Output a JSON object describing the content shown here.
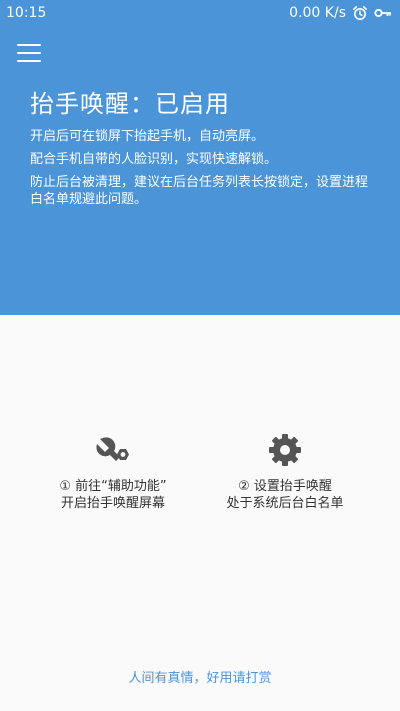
{
  "status_bar": {
    "time": "10:15",
    "net_speed": "0.00 K/s",
    "icons": [
      "alarm-icon",
      "key-icon"
    ]
  },
  "colors": {
    "header_bg": "#4a94d7",
    "accent": "#4a94d7",
    "icon_gray": "#555555",
    "body_bg": "#fafafa"
  },
  "header": {
    "menu_icon": "hamburger-menu-icon",
    "title": "抬手唤醒：已启用",
    "description": [
      "开启后可在锁屏下抬起手机，自动亮屏。",
      "配合手机自带的人脸识别，实现快速解锁。",
      "防止后台被清理，建议在后台任务列表长按锁定，设置进程白名单规避此问题。"
    ]
  },
  "actions": [
    {
      "icon": "accessibility-tools-icon",
      "line1": "① 前往“辅助功能”",
      "line2": "开启抬手唤醒屏幕"
    },
    {
      "icon": "settings-gear-icon",
      "line1": "② 设置抬手唤醒",
      "line2": "处于系统后台白名单"
    }
  ],
  "footer": {
    "link": "人间有真情，好用请打赏"
  }
}
